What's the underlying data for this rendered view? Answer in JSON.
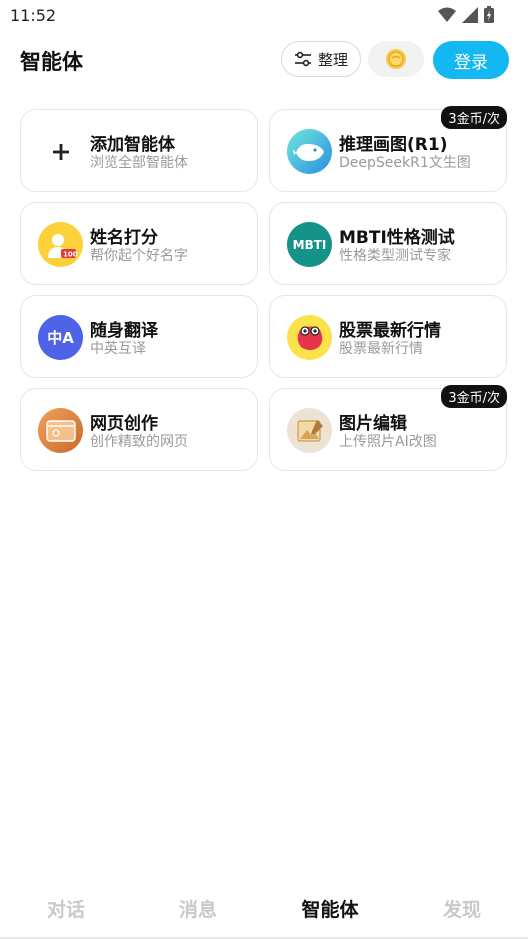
{
  "status": {
    "time": "11:52"
  },
  "header": {
    "title": "智能体",
    "sort_label": "整理",
    "login_label": "登录"
  },
  "cards": [
    {
      "title": "添加智能体",
      "subtitle": "浏览全部智能体",
      "icon": "plus-icon",
      "badge": ""
    },
    {
      "title": "推理画图(R1)",
      "subtitle": "DeepSeekR1文生图",
      "icon": "deepseek-whale-icon",
      "badge": "3金币/次"
    },
    {
      "title": "姓名打分",
      "subtitle": "帮你起个好名字",
      "icon": "name-score-icon",
      "badge": ""
    },
    {
      "title": "MBTI性格测试",
      "subtitle": "性格类型测试专家",
      "icon": "mbti-icon",
      "icon_text": "MBTI",
      "badge": ""
    },
    {
      "title": "随身翻译",
      "subtitle": "中英互译",
      "icon": "translate-icon",
      "icon_text": "中A",
      "badge": ""
    },
    {
      "title": "股票最新行情",
      "subtitle": "股票最新行情",
      "icon": "stock-mascot-icon",
      "badge": ""
    },
    {
      "title": "网页创作",
      "subtitle": "创作精致的网页",
      "icon": "webpage-icon",
      "badge": ""
    },
    {
      "title": "图片编辑",
      "subtitle": "上传照片AI改图",
      "icon": "image-edit-icon",
      "badge": "3金币/次"
    }
  ],
  "bottom_nav": [
    {
      "label": "对话",
      "active": false
    },
    {
      "label": "消息",
      "active": false
    },
    {
      "label": "智能体",
      "active": true
    },
    {
      "label": "发现",
      "active": false
    }
  ],
  "colors": {
    "accent": "#13b8f2",
    "badge_bg": "#111111"
  }
}
